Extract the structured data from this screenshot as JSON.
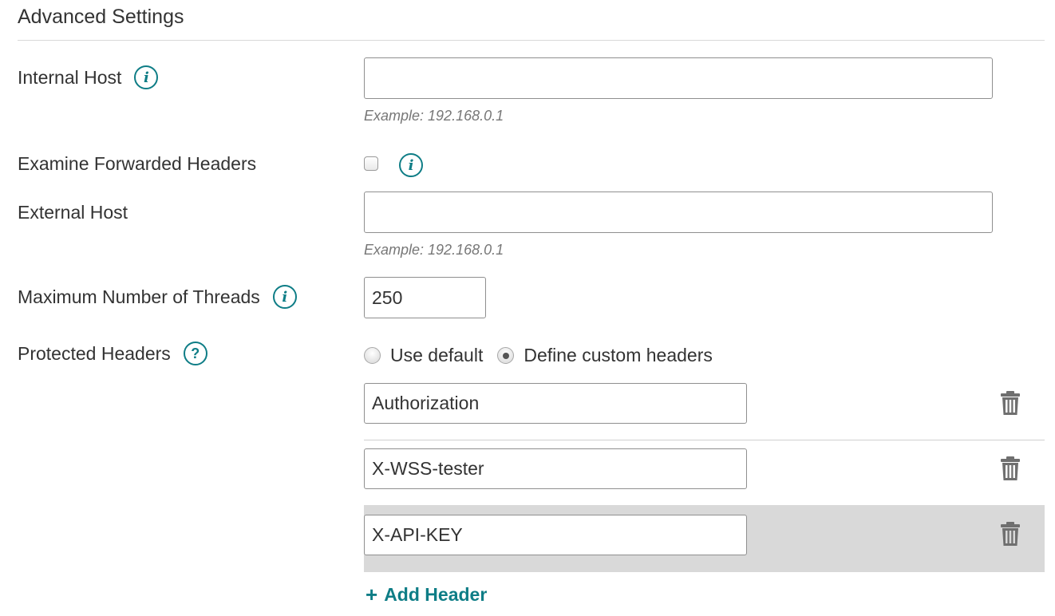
{
  "section": {
    "title": "Advanced Settings"
  },
  "internal_host": {
    "label": "Internal Host",
    "value": "",
    "hint": "Example: 192.168.0.1",
    "icon": "info-icon"
  },
  "examine_forwarded": {
    "label": "Examine Forwarded Headers",
    "checked": false,
    "icon": "info-icon"
  },
  "external_host": {
    "label": "External Host",
    "value": "",
    "hint": "Example: 192.168.0.1"
  },
  "max_threads": {
    "label": "Maximum Number of Threads",
    "value": "250",
    "icon": "info-icon"
  },
  "protected_headers": {
    "label": "Protected Headers",
    "icon": "help-icon",
    "options": [
      "Use default",
      "Define custom headers"
    ],
    "selected": "Define custom headers",
    "headers": [
      "Authorization",
      "X-WSS-tester",
      "X-API-KEY"
    ],
    "row_icon": "trash-icon",
    "add_label": "Add Header"
  },
  "colors": {
    "accent": "#0e7d86",
    "row_highlight": "#d9d9d9",
    "icon_gray": "#777777"
  }
}
